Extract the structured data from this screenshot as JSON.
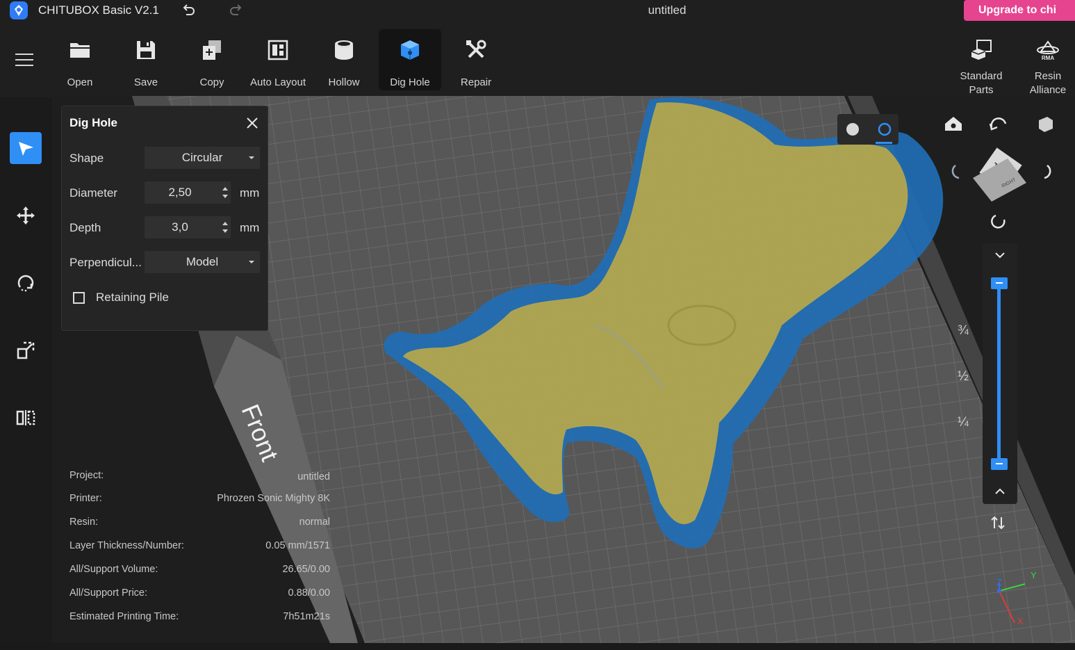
{
  "app": {
    "title": "CHITUBOX Basic V2.1",
    "document_title": "untitled",
    "upgrade_label": "Upgrade to  chi"
  },
  "toolbar": {
    "items": [
      {
        "label": "Open",
        "icon": "folder-icon"
      },
      {
        "label": "Save",
        "icon": "floppy-icon"
      },
      {
        "label": "Copy",
        "icon": "copy-icon"
      },
      {
        "label": "Auto Layout",
        "icon": "auto-layout-icon"
      },
      {
        "label": "Hollow",
        "icon": "hollow-icon"
      },
      {
        "label": "Dig Hole",
        "icon": "dig-hole-icon",
        "active": true
      },
      {
        "label": "Repair",
        "icon": "repair-icon"
      }
    ],
    "right_items": [
      {
        "label_line1": "Standard",
        "label_line2": "Parts",
        "icon": "standard-parts-icon"
      },
      {
        "label_line1": "Resin",
        "label_line2": "Alliance",
        "icon": "rma-icon"
      }
    ]
  },
  "sidebar": {
    "items": [
      {
        "name": "select-tool",
        "icon": "select-arrow-icon",
        "active": true
      },
      {
        "name": "move-tool",
        "icon": "move-icon"
      },
      {
        "name": "rotate-tool",
        "icon": "rotate-icon"
      },
      {
        "name": "scale-tool",
        "icon": "scale-icon"
      },
      {
        "name": "mirror-tool",
        "icon": "mirror-icon"
      }
    ]
  },
  "dig_hole_panel": {
    "title": "Dig Hole",
    "shape_label": "Shape",
    "shape_value": "Circular",
    "diameter_label": "Diameter",
    "diameter_value": "2,50",
    "diameter_unit": "mm",
    "depth_label": "Depth",
    "depth_value": "3,0",
    "depth_unit": "mm",
    "perpendicular_label": "Perpendicul...",
    "perpendicular_value": "Model",
    "retaining_pile_label": "Retaining Pile",
    "retaining_pile_checked": false
  },
  "viewport": {
    "plate_label": "Front",
    "view_cube_top": "TOP",
    "view_cube_right": "RIGHT",
    "layer_slider_marks": [
      "¾",
      "½",
      "¼"
    ],
    "layer_slider_upper": 1.0,
    "layer_slider_lower": 0.0,
    "axes": {
      "x": "X",
      "y": "Y",
      "z": "Z"
    },
    "colors": {
      "model_shell": "#1f6fb8",
      "model_inner": "#b8a84a",
      "accent": "#2f8ff5",
      "grid": "#6b6b6b"
    }
  },
  "info": {
    "rows": [
      {
        "key": "Project:",
        "value": "untitled"
      },
      {
        "key": "Printer:",
        "value": "Phrozen Sonic Mighty 8K"
      },
      {
        "key": "Resin:",
        "value": "normal"
      },
      {
        "key": "Layer Thickness/Number:",
        "value": "0.05 mm/1571"
      },
      {
        "key": "All/Support Volume:",
        "value": "26.65/0.00"
      },
      {
        "key": "All/Support Price:",
        "value": "0.88/0.00"
      },
      {
        "key": "Estimated Printing Time:",
        "value": "7h51m21s"
      }
    ]
  }
}
